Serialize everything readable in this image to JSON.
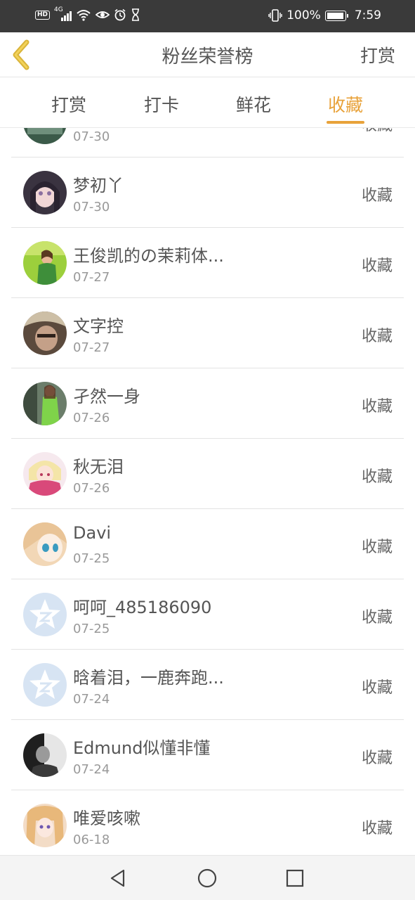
{
  "status_bar": {
    "hd": "HD",
    "network": "4G",
    "battery_percent": "100%",
    "battery_level": 1.0,
    "time": "7:59",
    "icons": [
      "hd-icon",
      "signal-icon",
      "wifi-icon",
      "eye-icon",
      "alarm-icon",
      "hourglass-icon",
      "vibrate-icon",
      "battery-icon"
    ]
  },
  "header": {
    "back_icon": "chevron-left-icon",
    "title": "粉丝荣誉榜",
    "action_label": "打赏"
  },
  "tabs": [
    {
      "label": "打赏",
      "active": false
    },
    {
      "label": "打卡",
      "active": false
    },
    {
      "label": "鲜花",
      "active": false
    },
    {
      "label": "收藏",
      "active": true
    }
  ],
  "colors": {
    "accent": "#e8a23a",
    "status_bar": "#3a3a3a",
    "default_avatar": "#d7e4f3"
  },
  "list": [
    {
      "name": "",
      "date": "07-30",
      "action": "收藏",
      "avatar": "photo-avatar"
    },
    {
      "name": "梦初丫",
      "date": "07-30",
      "action": "收藏",
      "avatar": "photo-avatar"
    },
    {
      "name": "王俊凯的の茉莉体...",
      "date": "07-27",
      "action": "收藏",
      "avatar": "photo-avatar"
    },
    {
      "name": "文字控",
      "date": "07-27",
      "action": "收藏",
      "avatar": "photo-avatar"
    },
    {
      "name": "孑然一身",
      "date": "07-26",
      "action": "收藏",
      "avatar": "photo-avatar"
    },
    {
      "name": "秋无泪",
      "date": "07-26",
      "action": "收藏",
      "avatar": "photo-avatar"
    },
    {
      "name": "Davi",
      "date": "07-25",
      "action": "收藏",
      "avatar": "photo-avatar"
    },
    {
      "name": "呵呵_485186090",
      "date": "07-25",
      "action": "收藏",
      "avatar": "default-star-avatar"
    },
    {
      "name": "晗着泪，一鹿奔跑...",
      "date": "07-24",
      "action": "收藏",
      "avatar": "default-star-avatar"
    },
    {
      "name": "Edmund似懂非懂",
      "date": "07-24",
      "action": "收藏",
      "avatar": "photo-avatar"
    },
    {
      "name": "唯爱咳嗽",
      "date": "06-18",
      "action": "收藏",
      "avatar": "photo-avatar"
    }
  ],
  "nav_bar": {
    "icons": [
      "back-triangle-icon",
      "home-circle-icon",
      "recents-square-icon"
    ]
  }
}
